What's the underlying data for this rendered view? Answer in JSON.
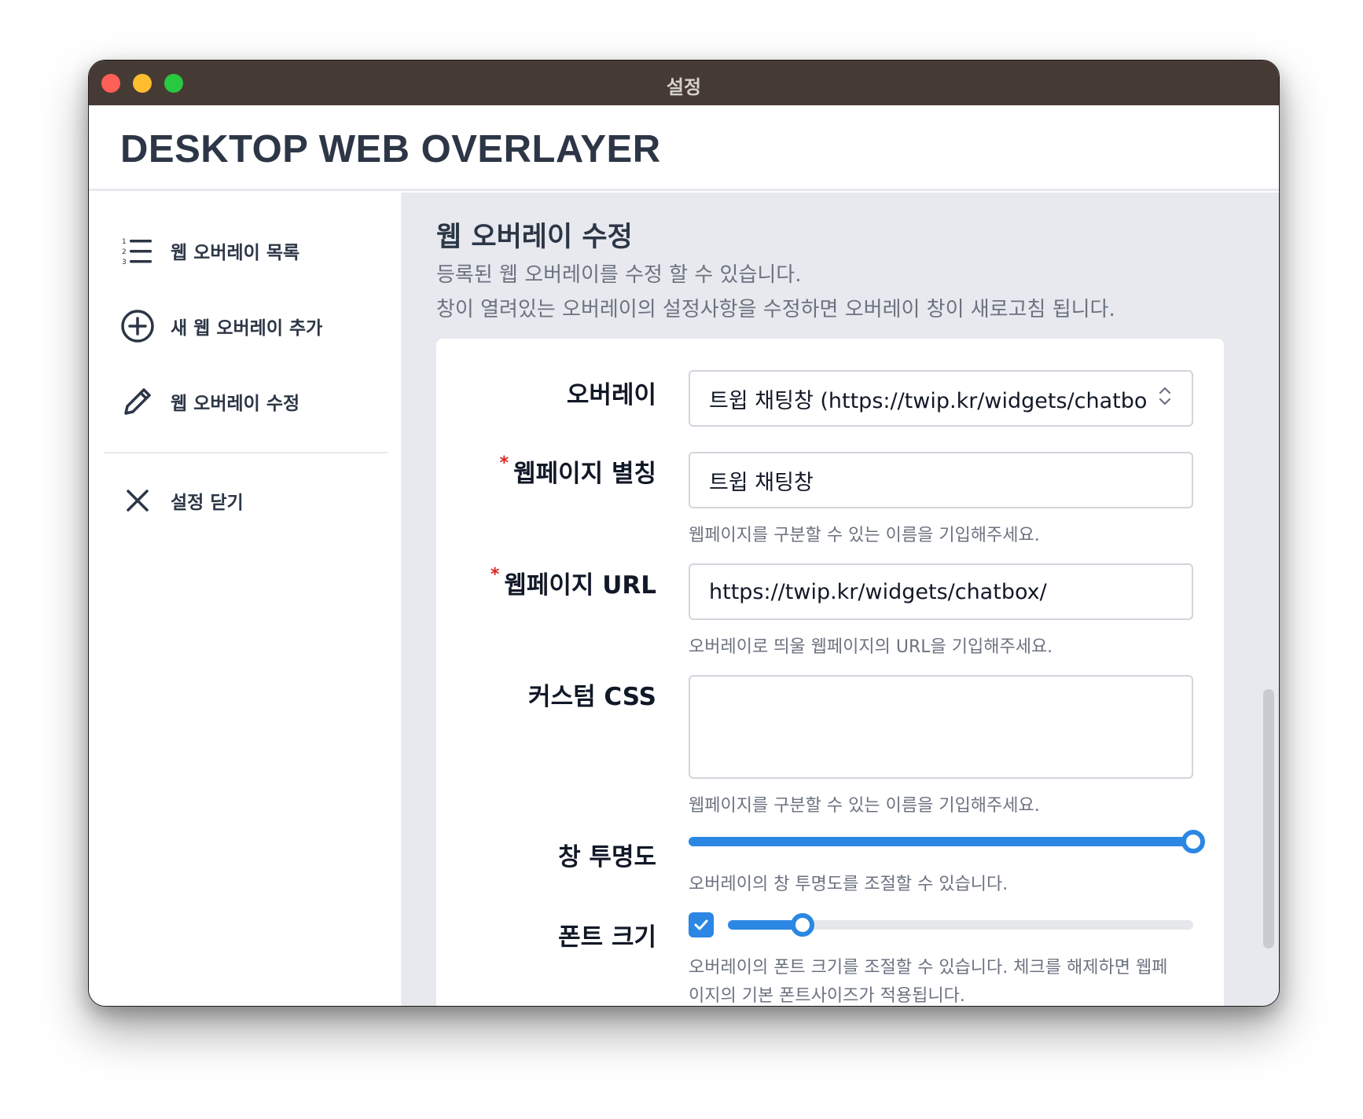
{
  "window": {
    "title": "설정"
  },
  "app": {
    "title": "DESKTOP WEB OVERLAYER"
  },
  "sidebar": {
    "items": [
      {
        "label": "웹 오버레이 목록",
        "icon": "numbered-list-icon"
      },
      {
        "label": "새 웹 오버레이 추가",
        "icon": "plus-circle-icon"
      },
      {
        "label": "웹 오버레이 수정",
        "icon": "pencil-icon"
      },
      {
        "label": "설정 닫기",
        "icon": "close-icon"
      }
    ]
  },
  "main": {
    "title": "웹 오버레이 수정",
    "description_1": "등록된 웹 오버레이를 수정 할 수 있습니다.",
    "description_2": "창이 열려있는 오버레이의 설정사항을 수정하면 오버레이 창이 새로고침 됩니다."
  },
  "form": {
    "overlay": {
      "label": "오버레이",
      "selected": "트윕 채팅창 (https://twip.kr/widgets/chatbox/"
    },
    "alias": {
      "required_mark": "*",
      "label": "웹페이지 별칭",
      "value": "트윕 채팅창",
      "hint": "웹페이지를 구분할 수 있는 이름을 기입해주세요."
    },
    "url": {
      "required_mark": "*",
      "label": "웹페이지 URL",
      "value": "https://twip.kr/widgets/chatbox/",
      "hint": "오버레이로 띄울 웹페이지의 URL을 기입해주세요."
    },
    "custom_css": {
      "label": "커스텀 CSS",
      "value": "",
      "hint": "웹페이지를 구분할 수 있는 이름을 기입해주세요."
    },
    "opacity": {
      "label": "창 투명도",
      "value_fraction": 1.0,
      "hint": "오버레이의 창 투명도를 조절할 수 있습니다."
    },
    "font_size": {
      "label": "폰트 크기",
      "checked": true,
      "value_fraction": 0.16,
      "hint_1": "오버레이의 폰트 크기를 조절할 수 있습니다. 체크를 해제하면 웹페",
      "hint_2": "이지의 기본 폰트사이즈가 적용됩니다."
    }
  },
  "colors": {
    "accent": "#2b87e3",
    "titlebar": "#463a35",
    "text_dark": "#2c3646",
    "required": "#e02424"
  }
}
